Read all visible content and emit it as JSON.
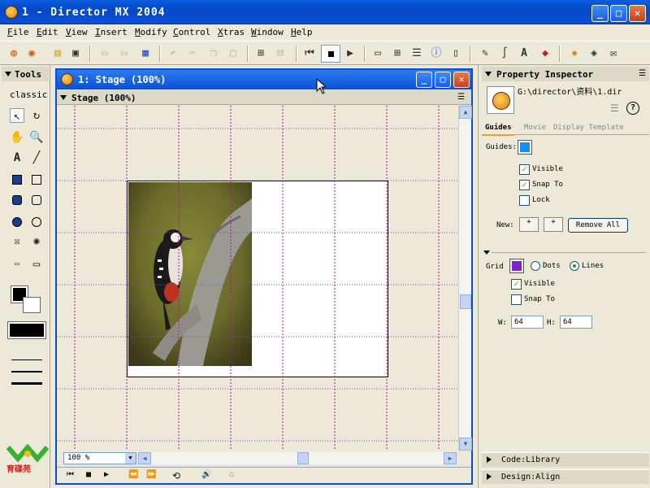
{
  "window": {
    "title": "1 - Director MX 2004",
    "minimize": "_",
    "maximize": "□",
    "close": "✕"
  },
  "menu": [
    "File",
    "Edit",
    "View",
    "Insert",
    "Modify",
    "Control",
    "Xtras",
    "Window",
    "Help"
  ],
  "toolbar": {
    "icons": [
      "new-movie-icon",
      "new-cast-icon",
      "open-icon",
      "import-icon",
      "save-icon",
      "save-all-icon",
      "publish-icon",
      "undo-icon",
      "cut-icon",
      "copy-icon",
      "paste-icon",
      "find-icon",
      "exchange-icon",
      "rewind-icon",
      "stop-icon",
      "play-icon",
      "stage-icon",
      "cast-icon",
      "score-icon",
      "info-icon",
      "library-icon",
      "paint-icon",
      "vector-icon",
      "text-icon",
      "shockwave-icon",
      "script-icon",
      "behavior-icon",
      "message-icon"
    ]
  },
  "tools": {
    "title": "Tools",
    "mode": "classic",
    "colors": {
      "foreground": "#000000",
      "background": "#ffffff"
    }
  },
  "stage": {
    "window_title": "1: Stage (100%)",
    "header": "Stage (100%)",
    "zoom": "100 %"
  },
  "inspector": {
    "title": "Property Inspector",
    "path": "G:\\director\\资料\\1.dir",
    "tabs": [
      "Guides",
      "Movie",
      "Display Template"
    ],
    "guides": {
      "label": "Guides:",
      "color": "#1a8ef0",
      "visible_label": "Visible",
      "visible": true,
      "snap_label": "Snap To",
      "snap": true,
      "lock_label": "Lock",
      "lock": false,
      "new_label": "New:",
      "h_plus": "+",
      "v_plus": "+",
      "remove_all": "Remove All"
    },
    "grid": {
      "label": "Grid",
      "color": "#8020d0",
      "dots_label": "Dots",
      "lines_label": "Lines",
      "visible_label": "Visible",
      "visible": true,
      "snap_label": "Snap To",
      "snap": false,
      "w_label": "W:",
      "w": "64",
      "h_label": "H:",
      "h": "64"
    },
    "panels": [
      "Code:Library",
      "Design:Align"
    ]
  }
}
